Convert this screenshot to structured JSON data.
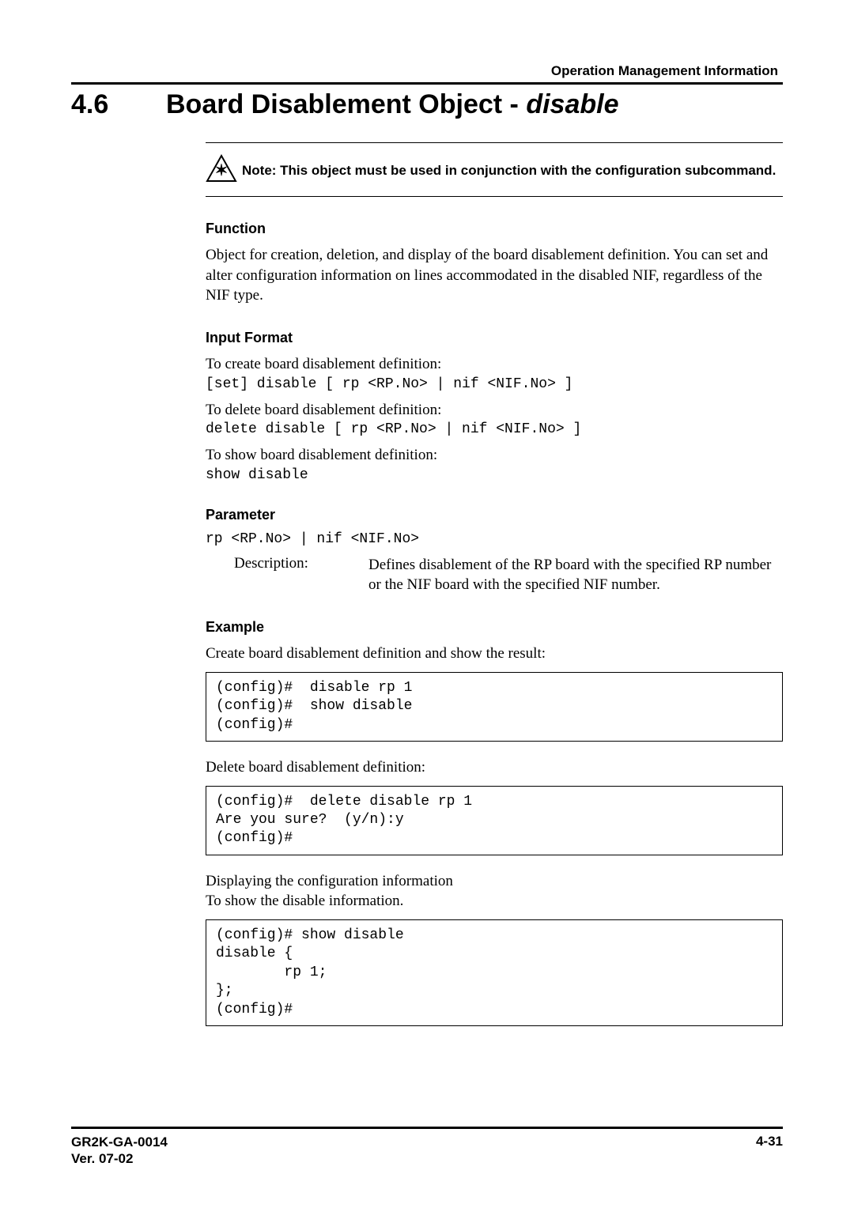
{
  "running_head": "Operation Management Information",
  "section": {
    "number": "4.6",
    "title_plain": "Board Disablement Object - ",
    "title_italic": "disable"
  },
  "note": {
    "text": "Note:  This object must be used in conjunction with the configuration subcommand."
  },
  "function": {
    "heading": "Function",
    "body": "Object for creation, deletion, and display of the board disablement definition. You can set and alter configuration information on lines accommodated in the disabled NIF, regardless of the NIF type."
  },
  "input_format": {
    "heading": "Input Format",
    "create_intro": "To create board disablement definition:",
    "create_cmd": "[set] disable [ rp <RP.No> | nif <NIF.No> ]",
    "delete_intro": "To delete board disablement definition:",
    "delete_cmd": "delete disable [ rp <RP.No> | nif <NIF.No> ]",
    "show_intro": "To show board disablement definition:",
    "show_cmd": "show disable"
  },
  "parameter": {
    "heading": "Parameter",
    "param_line": "rp <RP.No> | nif <NIF.No>",
    "desc_label": "Description:",
    "desc_body": "Defines disablement of the RP board with the specified RP number or the NIF board with the specified NIF number."
  },
  "example": {
    "heading": "Example",
    "create_intro": "Create board disablement definition and show the result:",
    "create_code": "(config)#  disable rp 1\n(config)#  show disable\n(config)#",
    "delete_intro": "Delete board disablement definition:",
    "delete_code": "(config)#  delete disable rp 1\nAre you sure?  (y/n):y\n(config)#",
    "show_intro_l1": "Displaying the configuration information",
    "show_intro_l2": "To show the disable information.",
    "show_code": "(config)# show disable\ndisable {\n        rp 1;\n};\n(config)#"
  },
  "footer": {
    "doc_id": "GR2K-GA-0014",
    "version": "Ver. 07-02",
    "page": "4-31"
  }
}
